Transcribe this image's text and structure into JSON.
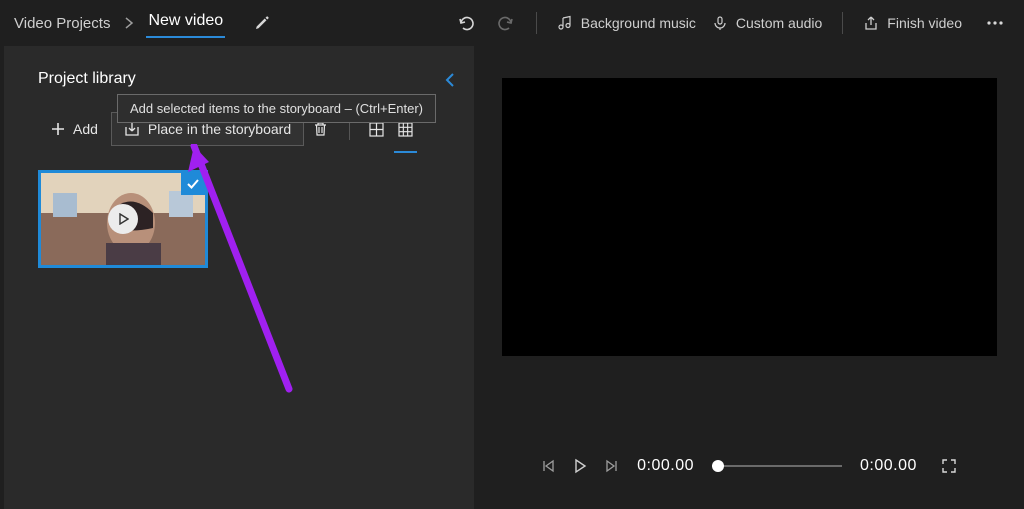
{
  "breadcrumb": {
    "root": "Video Projects",
    "current": "New video"
  },
  "top_actions": {
    "bg_music": "Background music",
    "custom_audio": "Custom audio",
    "finish": "Finish video"
  },
  "library": {
    "title": "Project library",
    "add_label": "Add",
    "place_label": "Place in the storyboard",
    "tooltip": "Add selected items to the storyboard – (Ctrl+Enter)"
  },
  "player": {
    "current_time": "0:00.00",
    "total_time": "0:00.00"
  }
}
